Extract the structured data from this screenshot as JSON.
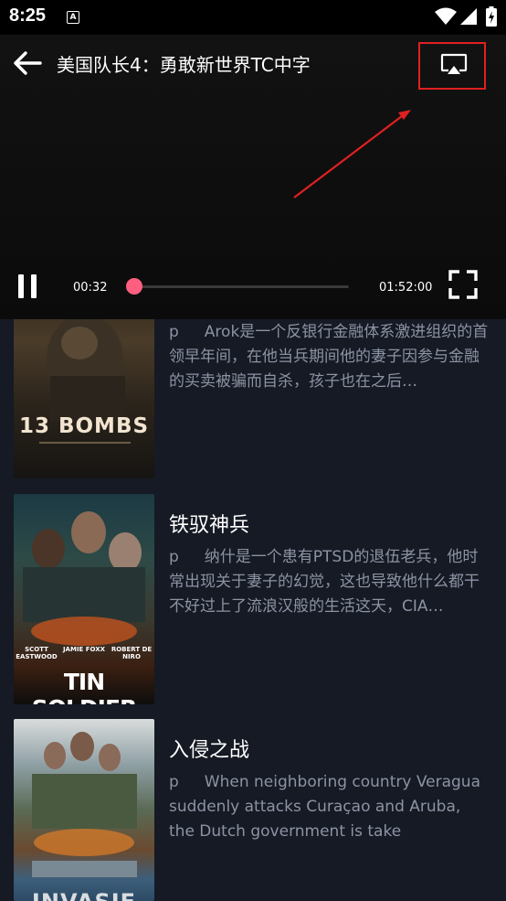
{
  "status_bar": {
    "time": "8:25",
    "notification_glyph": "A"
  },
  "player": {
    "title": "美国队长4：勇敢新世界TC中字",
    "current_time": "00:32",
    "duration": "01:52:00",
    "progress": 0.005,
    "icons": [
      "back-arrow-icon",
      "cast-icon",
      "pause-icon",
      "fullscreen-icon"
    ]
  },
  "colors": {
    "accent": "#ff5f7e",
    "highlight": "#e02020",
    "background": "#151a24"
  },
  "items": [
    {
      "title": "",
      "prefix": "p",
      "desc": "Arok是一个反银行金融体系激进组织的首领早年间，在他当兵期间他的妻子因参与金融的买卖被骗而自杀，孩子也在之后…",
      "poster_text": "13 BOMBS"
    },
    {
      "title": "铁驭神兵",
      "prefix": "p",
      "desc": "纳什是一个患有PTSD的退伍老兵，他时常出现关于妻子的幻觉，这也导致他什么都干不好过上了流浪汉般的生活这天，CIA…",
      "poster_text": "TIN SOLDIER",
      "poster_credits": [
        "SCOTT EASTWOOD",
        "JAMIE FOXX",
        "ROBERT DE NIRO"
      ]
    },
    {
      "title": "入侵之战",
      "prefix": "p",
      "desc": "When neighboring country Veragua suddenly attacks Curaçao and Aruba, the Dutch government is take",
      "poster_text": "INVASIE"
    }
  ]
}
